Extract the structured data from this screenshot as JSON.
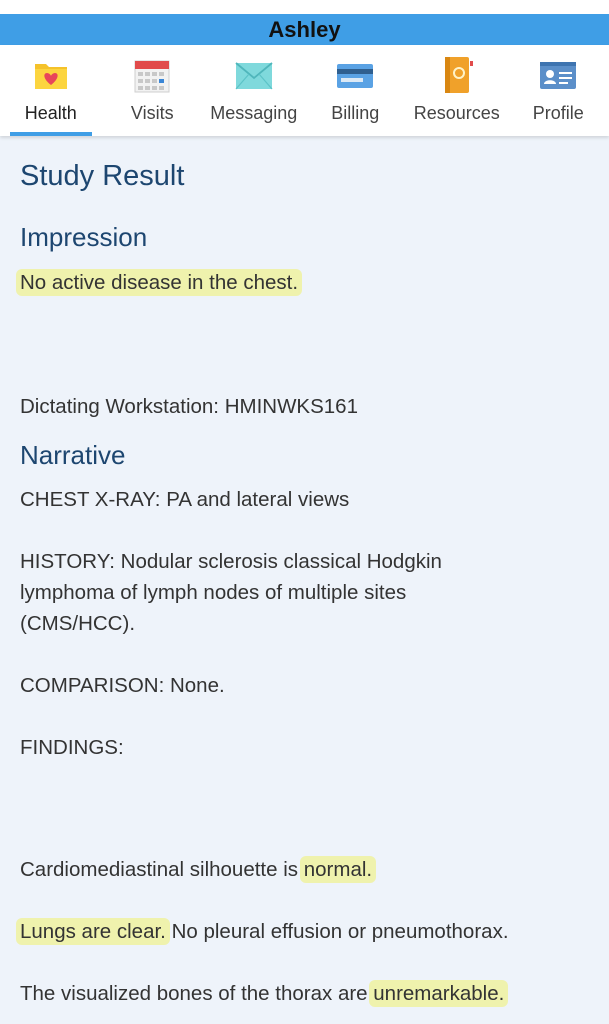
{
  "header": {
    "title": "Ashley",
    "accent": "#3f9ee6"
  },
  "tabs": [
    {
      "label": "Health",
      "icon": "heart-folder-icon",
      "active": true
    },
    {
      "label": "Visits",
      "icon": "calendar-icon"
    },
    {
      "label": "Messaging",
      "icon": "envelope-icon"
    },
    {
      "label": "Billing",
      "icon": "credit-card-icon"
    },
    {
      "label": "Resources",
      "icon": "book-icon"
    },
    {
      "label": "Profile",
      "icon": "id-card-icon"
    }
  ],
  "study": {
    "title": "Study Result",
    "impression_heading": "Impression",
    "impression_text": "No active disease in the chest.",
    "workstation": "Dictating Workstation: HMINWKS161",
    "narrative_heading": "Narrative",
    "exam": "CHEST X-RAY: PA and lateral views",
    "history": "HISTORY: Nodular sclerosis classical Hodgkin lymphoma of lymph nodes of multiple sites (CMS/HCC).",
    "comparison": "COMPARISON: None.",
    "findings_label": "FINDINGS:",
    "finding1_pre": "Cardiomediastinal silhouette is ",
    "finding1_hl": "normal.",
    "finding2_hl": "Lungs are clear.",
    "finding2_post": " No pleural effusion or pneumothorax.",
    "finding3_pre": "The visualized bones of the thorax are ",
    "finding3_hl": "unremarkable."
  }
}
